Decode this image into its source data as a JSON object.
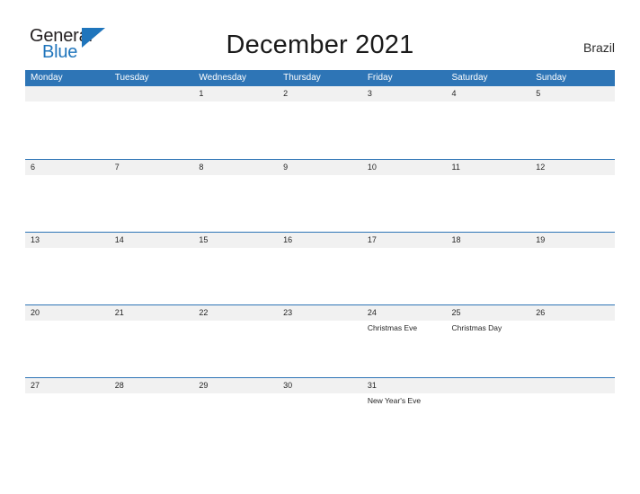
{
  "brand": {
    "name_part1": "General",
    "name_part2": "Blue",
    "triangle_icon": "triangle-icon",
    "accent_color": "#1f75bc"
  },
  "header": {
    "title": "December 2021",
    "country": "Brazil"
  },
  "colors": {
    "header_blue": "#2e75b6",
    "date_band_gray": "#f1f1f1",
    "text_dark": "#262626",
    "brand_blue": "#1f75bc"
  },
  "calendar": {
    "month": "December",
    "year": "2021",
    "weekday_headers": [
      "Monday",
      "Tuesday",
      "Wednesday",
      "Thursday",
      "Friday",
      "Saturday",
      "Sunday"
    ],
    "weeks": [
      [
        {
          "date": "",
          "event": ""
        },
        {
          "date": "",
          "event": ""
        },
        {
          "date": "1",
          "event": ""
        },
        {
          "date": "2",
          "event": ""
        },
        {
          "date": "3",
          "event": ""
        },
        {
          "date": "4",
          "event": ""
        },
        {
          "date": "5",
          "event": ""
        }
      ],
      [
        {
          "date": "6",
          "event": ""
        },
        {
          "date": "7",
          "event": ""
        },
        {
          "date": "8",
          "event": ""
        },
        {
          "date": "9",
          "event": ""
        },
        {
          "date": "10",
          "event": ""
        },
        {
          "date": "11",
          "event": ""
        },
        {
          "date": "12",
          "event": ""
        }
      ],
      [
        {
          "date": "13",
          "event": ""
        },
        {
          "date": "14",
          "event": ""
        },
        {
          "date": "15",
          "event": ""
        },
        {
          "date": "16",
          "event": ""
        },
        {
          "date": "17",
          "event": ""
        },
        {
          "date": "18",
          "event": ""
        },
        {
          "date": "19",
          "event": ""
        }
      ],
      [
        {
          "date": "20",
          "event": ""
        },
        {
          "date": "21",
          "event": ""
        },
        {
          "date": "22",
          "event": ""
        },
        {
          "date": "23",
          "event": ""
        },
        {
          "date": "24",
          "event": "Christmas Eve"
        },
        {
          "date": "25",
          "event": "Christmas Day"
        },
        {
          "date": "26",
          "event": ""
        }
      ],
      [
        {
          "date": "27",
          "event": ""
        },
        {
          "date": "28",
          "event": ""
        },
        {
          "date": "29",
          "event": ""
        },
        {
          "date": "30",
          "event": ""
        },
        {
          "date": "31",
          "event": "New Year's Eve"
        },
        {
          "date": "",
          "event": ""
        },
        {
          "date": "",
          "event": ""
        }
      ]
    ]
  }
}
